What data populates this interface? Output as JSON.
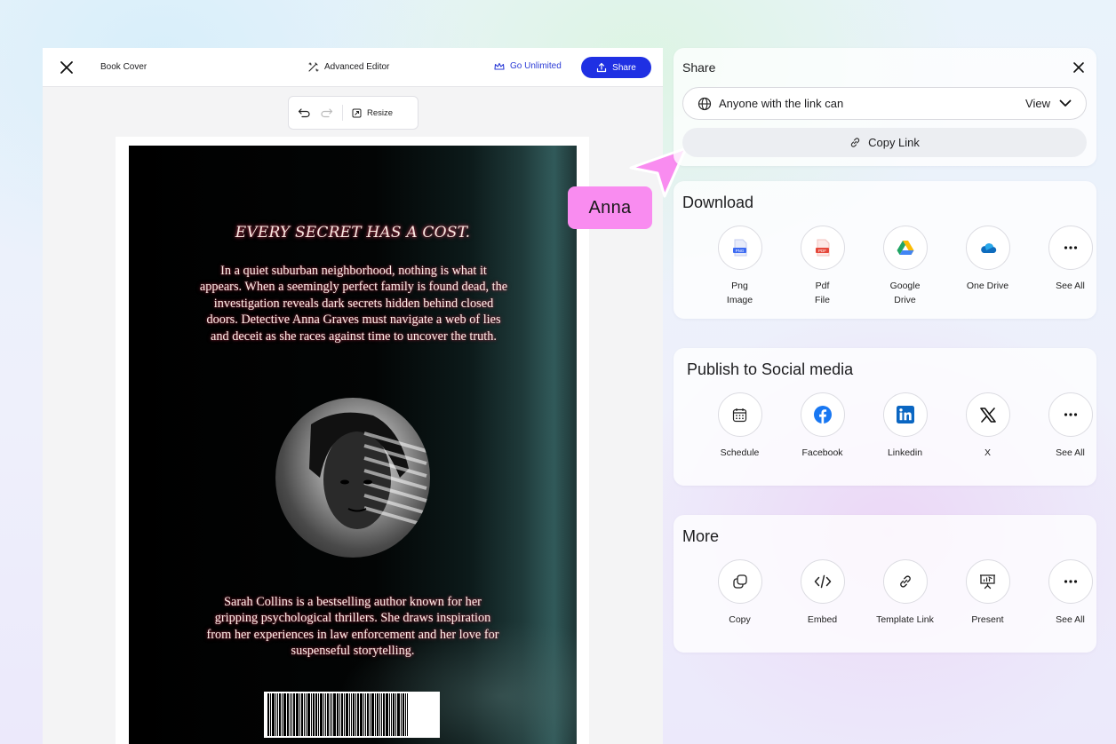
{
  "editor": {
    "doc_title": "Book Cover",
    "advanced_editor_label": "Advanced Editor",
    "go_unlimited_label": "Go Unlimited",
    "share_button_label": "Share",
    "resize_label": "Resize"
  },
  "cover": {
    "headline": "EVERY SECRET HAS A COST.",
    "blurb": "In a quiet suburban neighborhood, nothing is what it appears. When a seemingly perfect family is found dead, the investigation reveals dark secrets hidden behind closed doors. Detective Anna Graves must navigate a web of lies and deceit as she races against time to uncover the truth.",
    "author_bio": "Sarah Collins is a bestselling author known for her gripping psychological thrillers. She draws inspiration from her experiences in law enforcement and her love for suspenseful storytelling."
  },
  "collaborator": {
    "name": "Anna",
    "color": "#f98cf0"
  },
  "share_panel": {
    "title": "Share",
    "link_access_label": "Anyone with the link can",
    "permission_value": "View",
    "copy_link_label": "Copy Link"
  },
  "download": {
    "title": "Download",
    "items": [
      {
        "line1": "Png",
        "line2": "Image",
        "icon": "png-file-icon"
      },
      {
        "line1": "Pdf",
        "line2": "File",
        "icon": "pdf-file-icon"
      },
      {
        "line1": "Google",
        "line2": "Drive",
        "icon": "google-drive-icon"
      },
      {
        "line1": "One Drive",
        "line2": "",
        "icon": "onedrive-icon"
      },
      {
        "line1": "See All",
        "line2": "",
        "icon": "more-dots-icon"
      }
    ]
  },
  "social": {
    "title": "Publish to Social media",
    "items": [
      {
        "label": "Schedule",
        "icon": "calendar-icon"
      },
      {
        "label": "Facebook",
        "icon": "facebook-icon"
      },
      {
        "label": "Linkedin",
        "icon": "linkedin-icon"
      },
      {
        "label": "X",
        "icon": "x-logo-icon"
      },
      {
        "label": "See All",
        "icon": "more-dots-icon"
      }
    ]
  },
  "more": {
    "title": "More",
    "items": [
      {
        "label": "Copy",
        "icon": "copy-icon"
      },
      {
        "label": "Embed",
        "icon": "code-icon"
      },
      {
        "label": "Template Link",
        "icon": "link-icon"
      },
      {
        "label": "Present",
        "icon": "presentation-icon"
      },
      {
        "label": "See All",
        "icon": "more-dots-icon"
      }
    ]
  },
  "colors": {
    "accent_blue": "#1f30e3",
    "facebook_blue": "#1877f2",
    "linkedin_blue": "#0a66c2"
  }
}
